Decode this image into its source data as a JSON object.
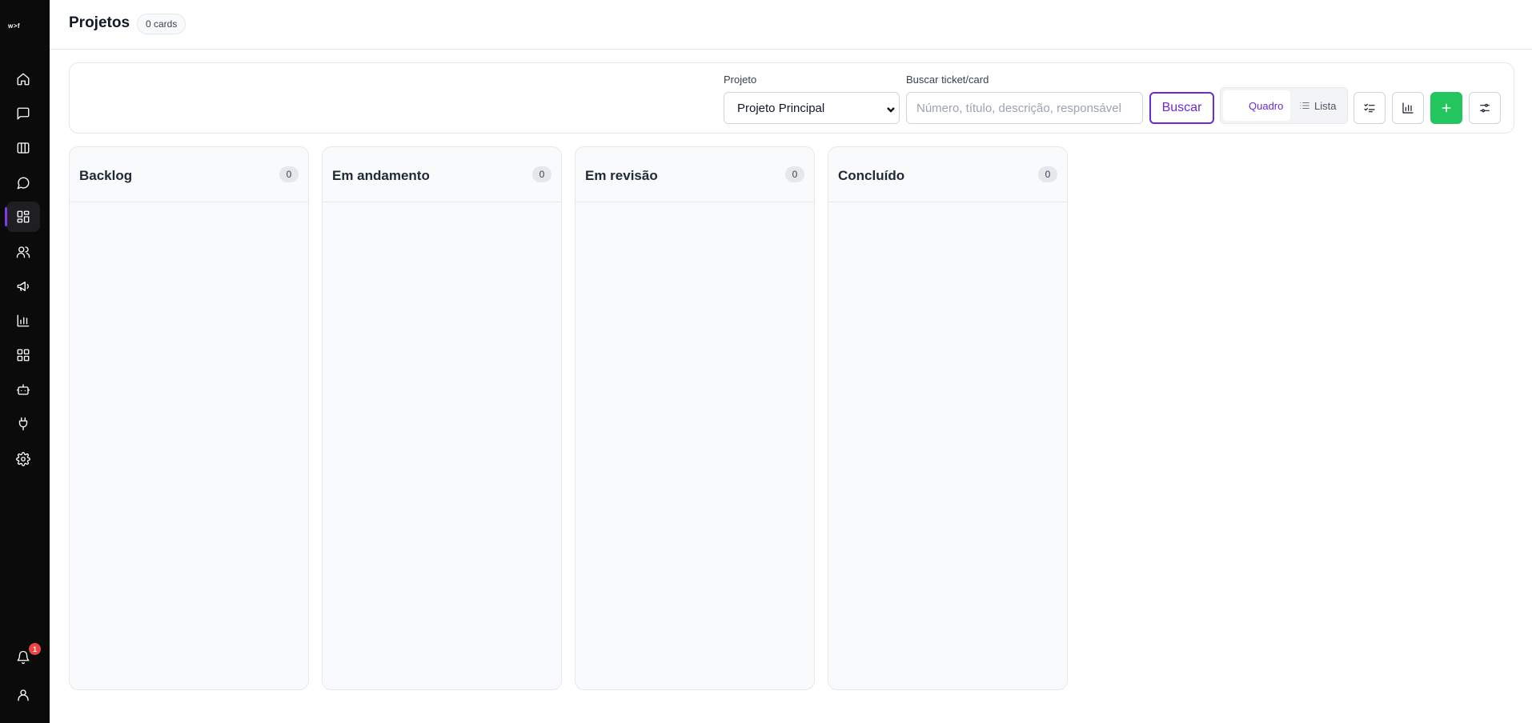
{
  "sidebar": {
    "logo_text": "w>f",
    "items": [
      {
        "name": "home",
        "icon": "home-icon"
      },
      {
        "name": "conversations",
        "icon": "message-square-icon"
      },
      {
        "name": "kanban",
        "icon": "columns-icon"
      },
      {
        "name": "chat",
        "icon": "message-circle-icon"
      },
      {
        "name": "projects",
        "icon": "layout-dashboard-icon",
        "active": true
      },
      {
        "name": "contacts",
        "icon": "users-icon"
      },
      {
        "name": "campaigns",
        "icon": "megaphone-icon"
      },
      {
        "name": "reports",
        "icon": "bar-chart-icon"
      },
      {
        "name": "apps",
        "icon": "grid-icon"
      },
      {
        "name": "bots",
        "icon": "bot-icon"
      },
      {
        "name": "integrations",
        "icon": "plug-icon"
      },
      {
        "name": "settings",
        "icon": "gear-icon"
      }
    ],
    "notifications_count": "1"
  },
  "header": {
    "title": "Projetos",
    "cards_count": "0 cards"
  },
  "toolbar": {
    "project_label": "Projeto",
    "project_selected": "Projeto Principal",
    "search_label": "Buscar ticket/card",
    "search_placeholder": "Número, título, descrição, responsável",
    "search_button": "Buscar",
    "view_board": "Quadro",
    "view_list": "Lista"
  },
  "columns": [
    {
      "title": "Backlog",
      "count": "0"
    },
    {
      "title": "Em andamento",
      "count": "0"
    },
    {
      "title": "Em revisão",
      "count": "0"
    },
    {
      "title": "Concluído",
      "count": "0"
    }
  ],
  "colors": {
    "accent": "#6d28d9",
    "add_button": "#22c55e",
    "sidebar_bg": "#0b0b0b",
    "badge": "#ef4444"
  }
}
